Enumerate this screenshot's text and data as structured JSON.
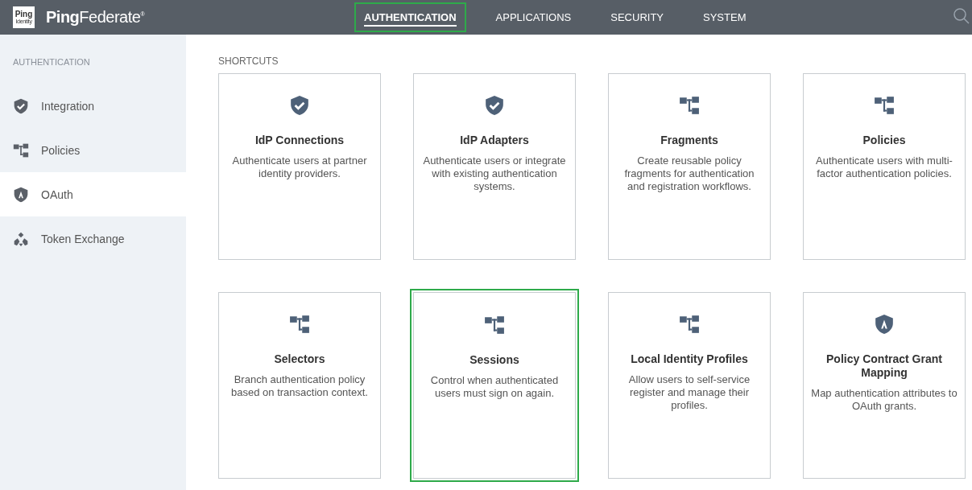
{
  "header": {
    "logo_badge": "Ping",
    "logo_badge_sub": "Identity",
    "logo_bold": "Ping",
    "logo_light": "Federate",
    "logo_mark": "®",
    "nav": [
      {
        "label": "AUTHENTICATION",
        "selected": true,
        "highlighted": true
      },
      {
        "label": "APPLICATIONS",
        "selected": false,
        "highlighted": false
      },
      {
        "label": "SECURITY",
        "selected": false,
        "highlighted": false
      },
      {
        "label": "SYSTEM",
        "selected": false,
        "highlighted": false
      }
    ]
  },
  "sidebar": {
    "heading": "AUTHENTICATION",
    "items": [
      {
        "label": "Integration",
        "kind": "shield",
        "selected": false
      },
      {
        "label": "Policies",
        "kind": "tree",
        "selected": false
      },
      {
        "label": "OAuth",
        "kind": "badge",
        "selected": true
      },
      {
        "label": "Token Exchange",
        "kind": "exchange",
        "selected": false
      }
    ]
  },
  "shortcuts": {
    "heading": "SHORTCUTS",
    "cards": [
      {
        "title": "IdP Connections",
        "description": "Authenticate users at partner identity providers.",
        "kind": "shield",
        "highlighted": false
      },
      {
        "title": "IdP Adapters",
        "description": "Authenticate users or integrate with existing authentication systems.",
        "kind": "shield",
        "highlighted": false
      },
      {
        "title": "Fragments",
        "description": "Create reusable policy fragments for authentication and registration workflows.",
        "kind": "tree",
        "highlighted": false
      },
      {
        "title": "Policies",
        "description": "Authenticate users with multi-factor authentication policies.",
        "kind": "tree",
        "highlighted": false
      },
      {
        "title": "Selectors",
        "description": "Branch authentication policy based on transaction context.",
        "kind": "tree",
        "highlighted": false
      },
      {
        "title": "Sessions",
        "description": "Control when authenticated users must sign on again.",
        "kind": "tree",
        "highlighted": true
      },
      {
        "title": "Local Identity Profiles",
        "description": "Allow users to self-service register and manage their profiles.",
        "kind": "tree",
        "highlighted": false
      },
      {
        "title": "Policy Contract Grant Mapping",
        "description": "Map authentication attributes to OAuth grants.",
        "kind": "badge",
        "highlighted": false
      }
    ]
  }
}
